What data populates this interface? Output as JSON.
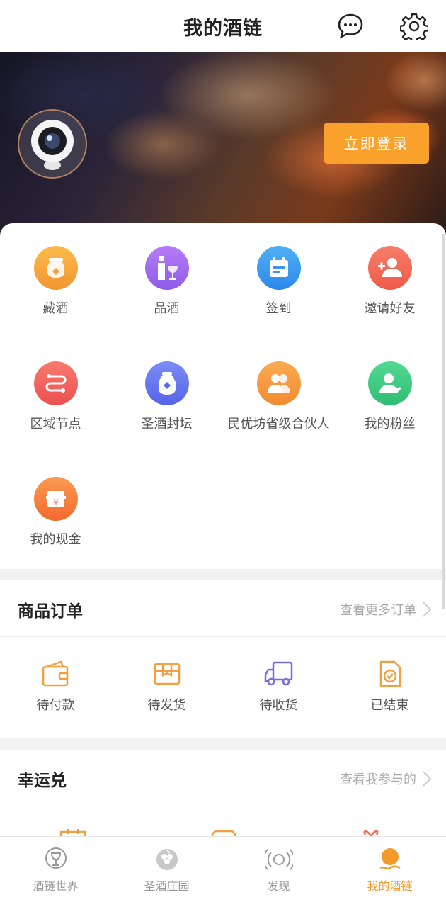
{
  "header": {
    "title": "我的酒链"
  },
  "banner": {
    "login_label": "立即登录"
  },
  "grid": [
    {
      "label": "藏酒",
      "icon": "jar-icon",
      "color": "#f7a93a"
    },
    {
      "label": "品酒",
      "icon": "wine-bottle-icon",
      "color": "#a06cf0"
    },
    {
      "label": "签到",
      "icon": "calendar-icon",
      "color": "#3f9df2"
    },
    {
      "label": "邀请好友",
      "icon": "add-friend-icon",
      "color": "#f26a5a"
    },
    {
      "label": "区域节点",
      "icon": "route-icon",
      "color": "#f05a5a"
    },
    {
      "label": "圣酒封坛",
      "icon": "seal-jar-icon",
      "color": "#6a7bf0"
    },
    {
      "label": "民优坊省级合伙人",
      "icon": "partners-icon",
      "color": "#f79a3a"
    },
    {
      "label": "我的粉丝",
      "icon": "fans-icon",
      "color": "#3ccc84"
    },
    {
      "label": "我的现金",
      "icon": "cash-icon",
      "color": "#f78a3a"
    }
  ],
  "orders": {
    "title": "商品订单",
    "more": "查看更多订单",
    "items": [
      {
        "label": "待付款",
        "icon": "wallet-icon"
      },
      {
        "label": "待发货",
        "icon": "package-icon"
      },
      {
        "label": "待收货",
        "icon": "truck-icon"
      },
      {
        "label": "已结束",
        "icon": "done-doc-icon"
      }
    ]
  },
  "lucky": {
    "title": "幸运兑",
    "more": "查看我参与的"
  },
  "tabs": [
    {
      "label": "酒链世界",
      "icon": "cup-icon",
      "active": false
    },
    {
      "label": "圣酒庄园",
      "icon": "grape-icon",
      "active": false
    },
    {
      "label": "发现",
      "icon": "signal-icon",
      "active": false
    },
    {
      "label": "我的酒链",
      "icon": "profile-icon",
      "active": true
    }
  ],
  "colors": {
    "accent": "#f9a12a",
    "active_tab": "#f39a2b"
  }
}
